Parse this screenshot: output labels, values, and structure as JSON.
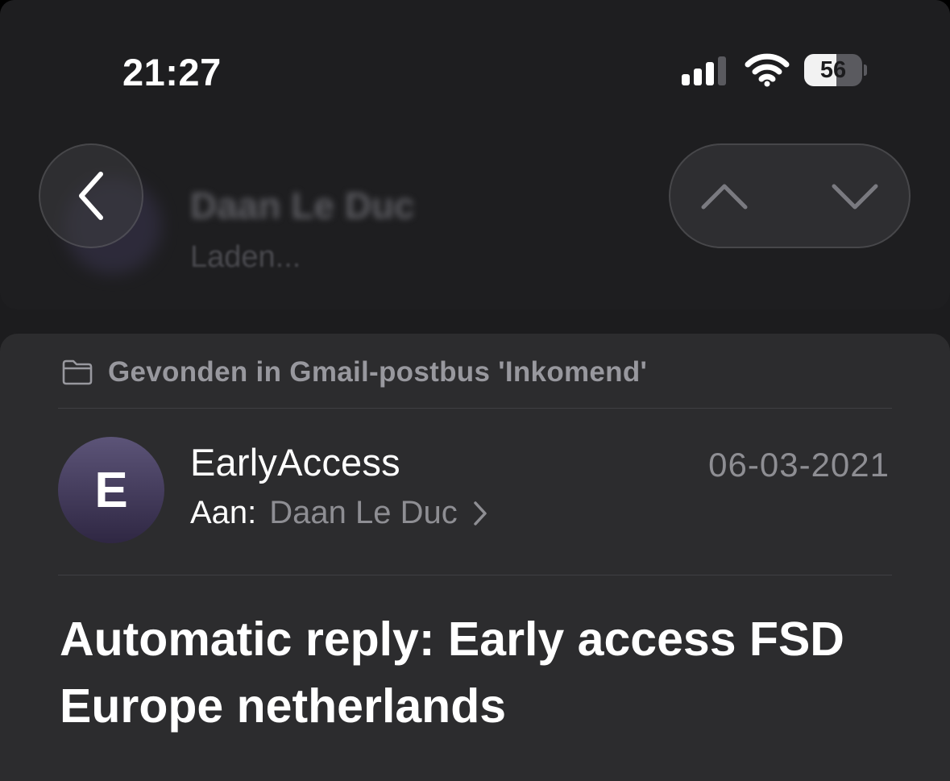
{
  "status_bar": {
    "time": "21:27",
    "signal_icon": "cellular-signal-icon",
    "wifi_icon": "wifi-icon",
    "battery_level": 56,
    "battery_text": "56"
  },
  "header": {
    "contact_name": "Daan Le Duc",
    "contact_status": "Laden...",
    "back_icon": "chevron-left-icon",
    "prev_icon": "chevron-up-icon",
    "next_icon": "chevron-down-icon"
  },
  "message": {
    "found_in": "Gevonden in Gmail-postbus 'Inkomend'",
    "folder_icon": "folder-icon",
    "avatar_initial": "E",
    "sender": "EarlyAccess",
    "date": "06-03-2021",
    "to_label": "Aan:",
    "to_name": "Daan Le Duc",
    "subject": "Automatic reply: Early access FSD Europe netherlands"
  },
  "colors": {
    "background": "#1c1c1e",
    "card": "#2c2c2e",
    "secondary_text": "#8e8e93",
    "avatar_gradient_top": "#5c5478",
    "avatar_gradient_bottom": "#2f2743"
  }
}
